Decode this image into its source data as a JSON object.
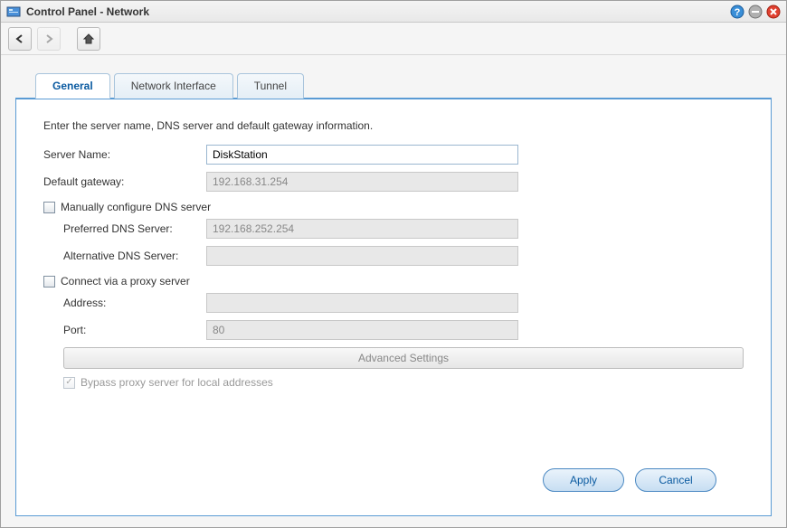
{
  "window": {
    "title": "Control Panel - Network"
  },
  "tabs": {
    "general": "General",
    "network_interface": "Network Interface",
    "tunnel": "Tunnel"
  },
  "general": {
    "intro": "Enter the server name, DNS server and default gateway information.",
    "server_name_label": "Server Name:",
    "server_name_value": "DiskStation",
    "default_gateway_label": "Default gateway:",
    "default_gateway_value": "192.168.31.254",
    "manual_dns_label": "Manually configure DNS server",
    "preferred_dns_label": "Preferred DNS Server:",
    "preferred_dns_value": "192.168.252.254",
    "alt_dns_label": "Alternative DNS Server:",
    "alt_dns_value": "",
    "proxy_label": "Connect via a proxy server",
    "proxy_address_label": "Address:",
    "proxy_address_value": "",
    "proxy_port_label": "Port:",
    "proxy_port_value": "80",
    "advanced_btn": "Advanced Settings",
    "bypass_label": "Bypass proxy server for local addresses"
  },
  "footer": {
    "apply": "Apply",
    "cancel": "Cancel"
  }
}
